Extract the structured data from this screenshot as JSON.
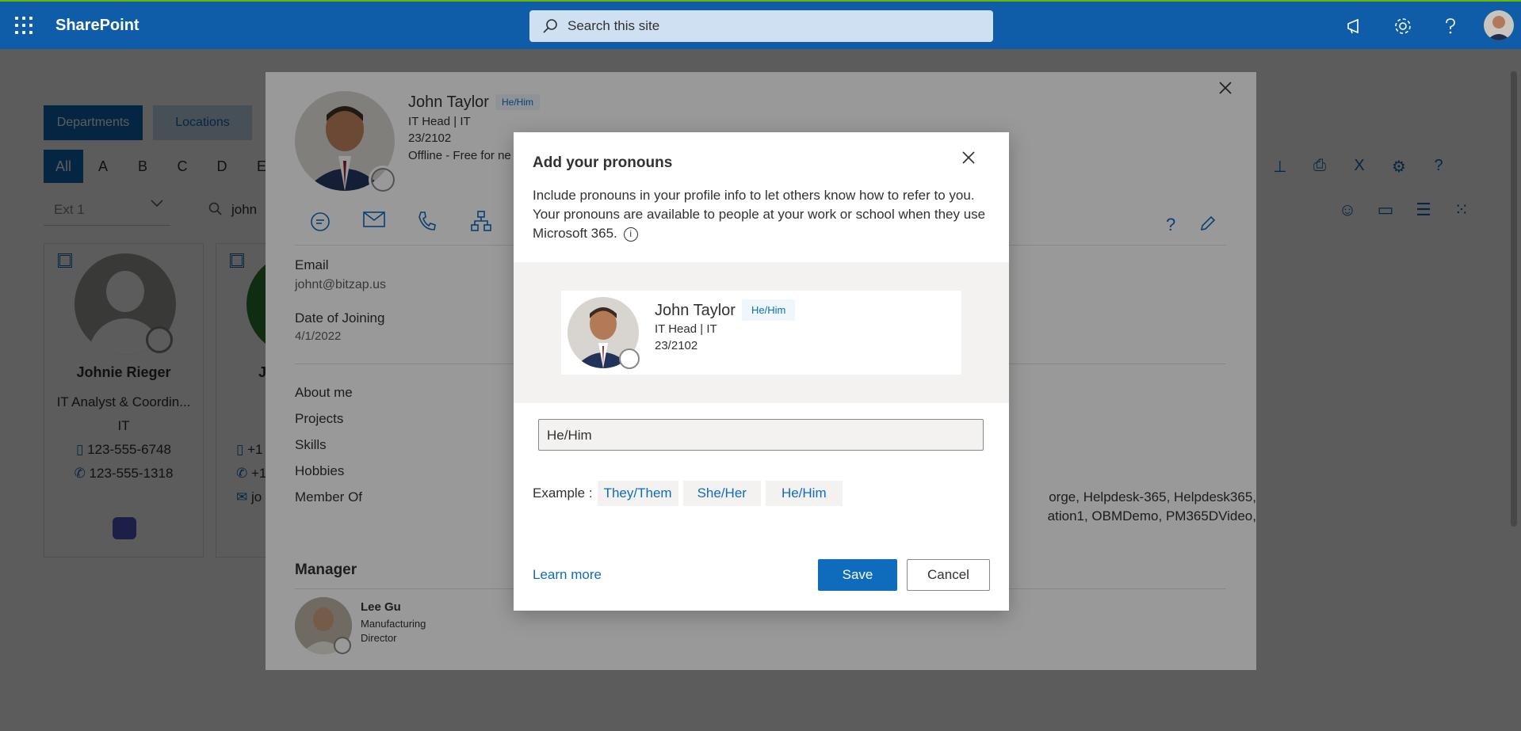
{
  "suitebar": {
    "app_name": "SharePoint",
    "search_placeholder": "Search this site"
  },
  "directory": {
    "tabs": [
      "Departments",
      "Locations"
    ],
    "alphabet": [
      "All",
      "A",
      "B",
      "C",
      "D",
      "E"
    ],
    "ext_filter": "Ext 1",
    "search_value": "john",
    "cards": [
      {
        "name": "Johnie Rieger",
        "title": "IT Analyst & Coordin...",
        "department": "IT",
        "mobile": "123-555-6748",
        "phone": "123-555-1318"
      },
      {
        "name": "Jo",
        "mobile": "+1",
        "phone": "+1",
        "email": "jo"
      }
    ]
  },
  "profile": {
    "name": "John Taylor",
    "pronoun": "He/Him",
    "title_line": "IT Head | IT",
    "location": "23/2102",
    "status": "Offline - Free for ne",
    "email_label": "Email",
    "email_value": "johnt@bitzap.us",
    "doj_label": "Date of Joining",
    "doj_value": "4/1/2022",
    "sections": [
      "About me",
      "Projects",
      "Skills",
      "Hobbies",
      "Member Of"
    ],
    "member_of_line1": "orge, Helpdesk-365, Helpdesk365,",
    "member_of_line2": "ation1, OBMDemo, PM365DVideo,",
    "manager_label": "Manager",
    "manager_name": "Lee Gu",
    "manager_title_1": "Manufacturing",
    "manager_title_2": "Director"
  },
  "dialog": {
    "title": "Add your pronouns",
    "description": "Include pronouns in your profile info to let others know how to refer to you. Your pronouns are available to people at your work or school when they use Microsoft 365.",
    "preview": {
      "name": "John Taylor",
      "pronoun": "He/Him",
      "title_line": "IT Head | IT",
      "location": "23/2102"
    },
    "input_value": "He/Him",
    "example_label": "Example :",
    "examples": [
      "They/Them",
      "She/Her",
      "He/Him"
    ],
    "learn_more": "Learn more",
    "save_label": "Save",
    "cancel_label": "Cancel"
  },
  "colors": {
    "suitebar": "#0f5ca8",
    "accent": "#0f6cbd",
    "overlay": "rgba(0,0,0,0.4)"
  }
}
